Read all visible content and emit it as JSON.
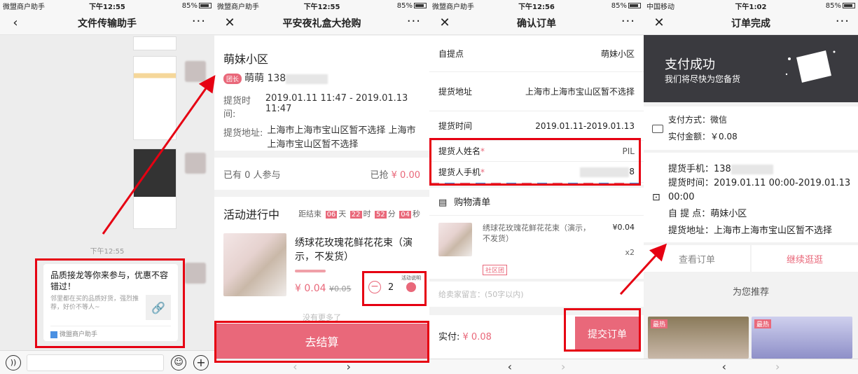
{
  "status": {
    "p1": {
      "carrier": "微盟商户助手",
      "time": "下午12:55",
      "battery": "85%"
    },
    "p2": {
      "carrier": "微盟商户助手",
      "time": "下午12:55",
      "battery": "85%"
    },
    "p3": {
      "carrier": "微盟商户助手",
      "time": "下午12:56",
      "battery": "85%"
    },
    "p4": {
      "carrier": "中国移动",
      "time": "下午1:02",
      "battery": "85%"
    }
  },
  "screen1": {
    "title": "文件传输助手",
    "timestamp": "下午12:55",
    "card_title": "品质接龙等你来参与，优惠不容错过！",
    "card_desc": "邻里都在买的品质好货，强烈推荐，好价不等人~",
    "card_source": "微盟商户助手"
  },
  "screen2": {
    "title": "平安夜礼盒大抢购",
    "community": "萌妹小区",
    "leader_tag": "团长",
    "leader_name": "萌萌 138",
    "pickup_time_label": "提货时间:",
    "pickup_time_value": "2019.01.11 11:47 - 2019.01.13 11:47",
    "pickup_addr_label": "提货地址:",
    "pickup_addr_value": "上海市上海市宝山区暂不选择 上海市上海市宝山区暂不选择",
    "participants": "已有 0 人参与",
    "sold_label": "已抢",
    "sold_amount": "¥ 0.00",
    "activity_label": "活动进行中",
    "countdown_label": "距结束",
    "cd_days": "06",
    "cd_days_unit": "天",
    "cd_hours": "22",
    "cd_hours_unit": "时",
    "cd_minutes": "52",
    "cd_minutes_unit": "分",
    "cd_seconds": "04",
    "cd_seconds_unit": "秒",
    "product_name": "绣球花玫瑰花鲜花花束（演示，不发货）",
    "price": "¥ 0.04",
    "orig_price": "¥0.05",
    "quantity": "2",
    "activity_note": "活动说明",
    "no_more": "没有更多了",
    "checkout": "去结算"
  },
  "screen3": {
    "title": "确认订单",
    "pickup_point_label": "自提点",
    "pickup_point_value": "萌妹小区",
    "pickup_addr_label": "提货地址",
    "pickup_addr_value": "上海市上海市宝山区暂不选择",
    "pickup_time_label": "提货时间",
    "pickup_time_value": "2019.01.11-2019.01.13",
    "name_label": "提货人姓名",
    "name_value": "PIL",
    "phone_label": "提货人手机",
    "phone_suffix": "8",
    "cart_title": "购物清单",
    "item_name": "绣球花玫瑰花鲜花花束（演示，不发货）",
    "item_price": "¥0.04",
    "item_qty": "x2",
    "item_tag": "社区团",
    "remark_placeholder": "给卖家留言：(50字以内)",
    "total_label": "实付:",
    "total_value": "¥ 0.08",
    "submit": "提交订单"
  },
  "screen4": {
    "title": "订单完成",
    "success_title": "支付成功",
    "success_sub": "我们将尽快为您备货",
    "pay_method": "支付方式：微信",
    "paid_amount": "实付金额：￥0.08",
    "pickup_phone_label": "提货手机：",
    "pickup_phone_value": "138",
    "pickup_time_label": "提货时间：",
    "pickup_time_value": "2019.01.11 00:00-2019.01.13 00:00",
    "pickup_point_label": "自 提 点：",
    "pickup_point_value": "萌妹小区",
    "pickup_addr_label": "提货地址：",
    "pickup_addr_value": "上海市上海市宝山区暂不选择",
    "view_order": "查看订单",
    "continue_shopping": "继续逛逛",
    "recommend": "为您推荐",
    "hot_tag": "最热"
  },
  "colors": {
    "accent": "#e9687a",
    "highlight": "#e60012",
    "banner": "#3a3a3f"
  }
}
